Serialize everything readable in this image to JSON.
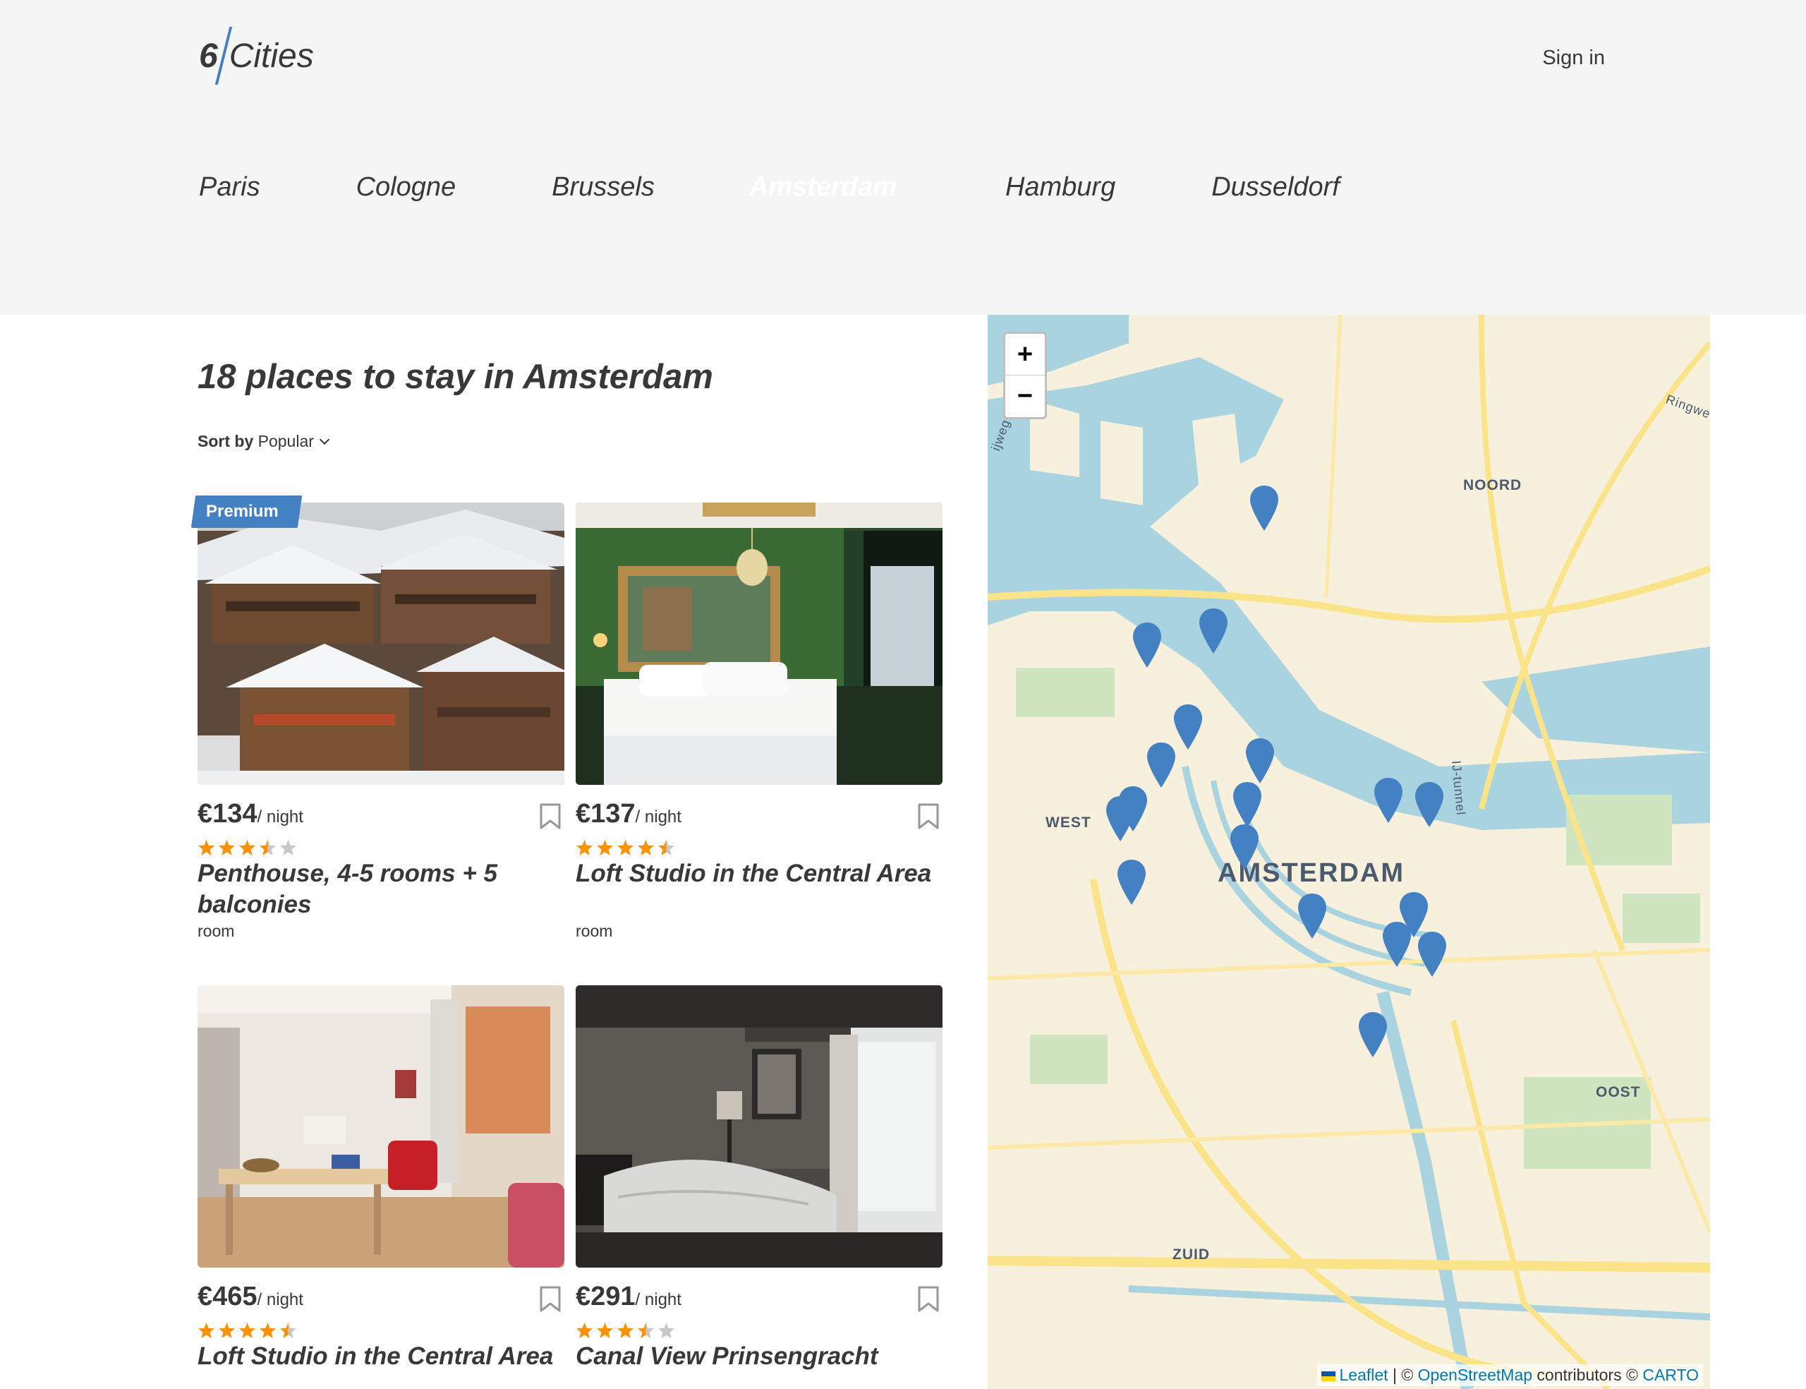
{
  "header": {
    "logo": {
      "number": "6",
      "word": "Cities"
    },
    "sign_in": "Sign in"
  },
  "tabs": [
    {
      "label": "Paris",
      "active": false
    },
    {
      "label": "Cologne",
      "active": false
    },
    {
      "label": "Brussels",
      "active": false
    },
    {
      "label": "Amsterdam",
      "active": true
    },
    {
      "label": "Hamburg",
      "active": false
    },
    {
      "label": "Dusseldorf",
      "active": false
    }
  ],
  "main": {
    "heading": "18 places to stay in Amsterdam",
    "sort": {
      "label": "Sort by",
      "value": "Popular"
    }
  },
  "offers": [
    {
      "premium_label": "Premium",
      "price": "€134",
      "per_night": "/ night",
      "rating": 3.5,
      "title": "Penthouse, 4-5 rooms + 5 balconies",
      "type": "room",
      "image": "chalet-photo"
    },
    {
      "premium_label": "",
      "price": "€137",
      "per_night": "/ night",
      "rating": 4.5,
      "title": "Loft Studio in the Central Area",
      "type": "room",
      "image": "green-bedroom-photo"
    },
    {
      "premium_label": "",
      "price": "€465",
      "per_night": "/ night",
      "rating": 4.5,
      "title": "Loft Studio in the Central Area",
      "type": "",
      "image": "living-room-photo"
    },
    {
      "premium_label": "",
      "price": "€291",
      "per_night": "/ night",
      "rating": 3.5,
      "title": "Canal View Prinsengracht",
      "type": "",
      "image": "dark-bedroom-photo"
    }
  ],
  "map": {
    "zoom_in": "+",
    "zoom_out": "−",
    "labels": {
      "noord": "NOORD",
      "west": "WEST",
      "city": "AMSTERDAM",
      "oost": "OOST",
      "zuid": "ZUID",
      "ringweg": "Ringwe",
      "tunnel": "IJ-tunnel",
      "left_road": "ijweg"
    },
    "attribution": {
      "leaflet": "Leaflet",
      "sep": "| ©",
      "osm": "OpenStreetMap",
      "contrib": "contributors ©",
      "carto": "CARTO"
    },
    "marker_count": 18,
    "marker_color": "#4481c3"
  },
  "colors": {
    "accent": "#4481c3",
    "star": "#ff9000",
    "star_empty": "#c7c7c7",
    "text": "#383838",
    "header_bg": "#f5f5f5"
  }
}
